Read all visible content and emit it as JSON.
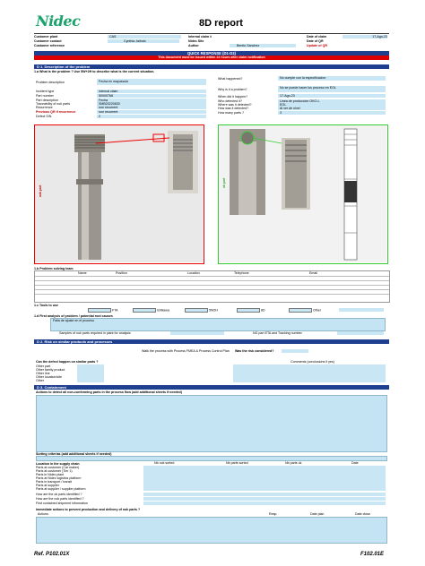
{
  "header": {
    "logo_text": "Nidec",
    "title": "8D report"
  },
  "top_fields": [
    {
      "label": "Customer plant",
      "value": "CAS",
      "label2": "Internal claim #",
      "value2": "",
      "label3": "Date of claim",
      "value3": "17-Ago-23"
    },
    {
      "label": "Customer contact",
      "value": "Cynthia Jalindo",
      "label2": "Nidec Site",
      "value2": "",
      "label3": "Date of QR",
      "value3": ""
    },
    {
      "label": "Customer reference",
      "value": "",
      "label2": "Author",
      "value2": "Benito Sanchez",
      "label3": "Update of QR",
      "value3": ""
    }
  ],
  "quick_response": {
    "title": "QUICK RESPONSE (D1-D3)",
    "subtitle": "This document must be issued within 24 hours after claim notification"
  },
  "d1": {
    "heading": "D 1. Description of the problem",
    "sub": "1.a What is the problem ? Use 5W+2H to describe what is the current situation.",
    "rows_left": [
      {
        "label": "Problem description",
        "value": "Fecha en mayusculo"
      },
      {
        "label": "Incident type",
        "value": "Internal claim"
      },
      {
        "label": "Part number",
        "value": "50000768"
      },
      {
        "label": "Part description",
        "value": "Fecha"
      },
      {
        "label": "Traceability of nok parts",
        "value": "SMB20220830"
      },
      {
        "label": "Recurrence",
        "value": "non recurrent"
      },
      {
        "label": "Previous QR if recurrence",
        "value": "non recurrent"
      },
      {
        "label": "Defect S/N",
        "value": "2"
      }
    ],
    "rows_right": [
      {
        "label": "What happened?",
        "value": "No cumple con la especificacion"
      },
      {
        "label": "Why is it a problem?",
        "value": "No se puede hacer los proceso en EOL"
      },
      {
        "label": "When did it happen?",
        "value": "17-Ago-23"
      },
      {
        "label": "Who detected it?",
        "value": "Linea de produccion OKO-L"
      },
      {
        "label": "Where was it detected?",
        "value": "EOL"
      },
      {
        "label": "How was it detected?",
        "value": "Al ver de nivel"
      },
      {
        "label": "How many parts ?",
        "value": "3"
      }
    ],
    "nok_label": "nok part",
    "ok_label": "ok part"
  },
  "team": {
    "heading": "1.b Problem solving team",
    "columns": [
      "Name",
      "Position",
      "Location",
      "Telephone",
      "Email"
    ]
  },
  "tools": {
    "heading": "1.c Tools to use",
    "items": [
      "FTA",
      "Ishikawa",
      "5W2H",
      "8D",
      "Other"
    ]
  },
  "analysis": {
    "heading": "1.d First analysis of problem / potential root causes",
    "value": "Falla de ajuste en el proceso",
    "samples_label": "Samples of nok parts required in plant for analysis",
    "ng_label": "NG part ETA and Tracking number"
  },
  "d2": {
    "heading": "D 2. Risk on similar products and processes",
    "walk": "Walk the process with Process FMEA & Process Control Plan",
    "was_considered": "Was the risk considered?",
    "question": "Can the defect happen on similar parts ?",
    "comments_label": "Comments (conclusions if yes)",
    "items": [
      "Other part",
      "Other family product",
      "Other line",
      "Other location/site",
      "Other"
    ]
  },
  "d3": {
    "heading": "D 3. Containment",
    "actions_label": "Actions to detect all non-conforming parts in the process flow (add additional sheets if needed)",
    "sorting_label": "Sorting criterias (add additional sheets if needed)",
    "supply_label": "Location in the supply chain",
    "supply_cols": [
      "Nb nok sorted",
      "Nb parts sorted",
      "Nb parts ok",
      "Date"
    ],
    "supply_rows": [
      "Parts at customer (Car maker)",
      "Parts at customer (Tier 1)",
      "Parts in Nidec plant",
      "Parts at Nidec logistics platform",
      "Parts in transport / transit",
      "Parts at supplier",
      "Parts at supplier / supplier platform"
    ],
    "q1": "How are the ok parts identified ?",
    "q2": "How are the nok parts identified ?",
    "q3": "First contained shipment information",
    "immediate": "Immediate actions to prevent production and delivery of nok parts ?",
    "imm_cols": [
      "Actions",
      "Resp.",
      "Date plan",
      "Date close"
    ]
  },
  "footer": {
    "left": "Ref. P102.01X",
    "right": "F102.01E"
  }
}
